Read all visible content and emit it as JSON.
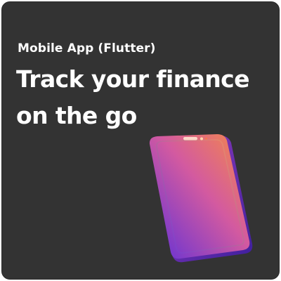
{
  "card": {
    "subtitle": "Mobile App (Flutter)",
    "headline": {
      "line1": "Track your finance",
      "line2": "on the go"
    }
  },
  "colors": {
    "background": "#333333",
    "text": "#ffffff",
    "phone_gradient_start": "#f07a4c",
    "phone_gradient_mid": "#c94fb0",
    "phone_gradient_end": "#5a2ed6"
  },
  "illustration": {
    "icon": "smartphone-icon"
  }
}
